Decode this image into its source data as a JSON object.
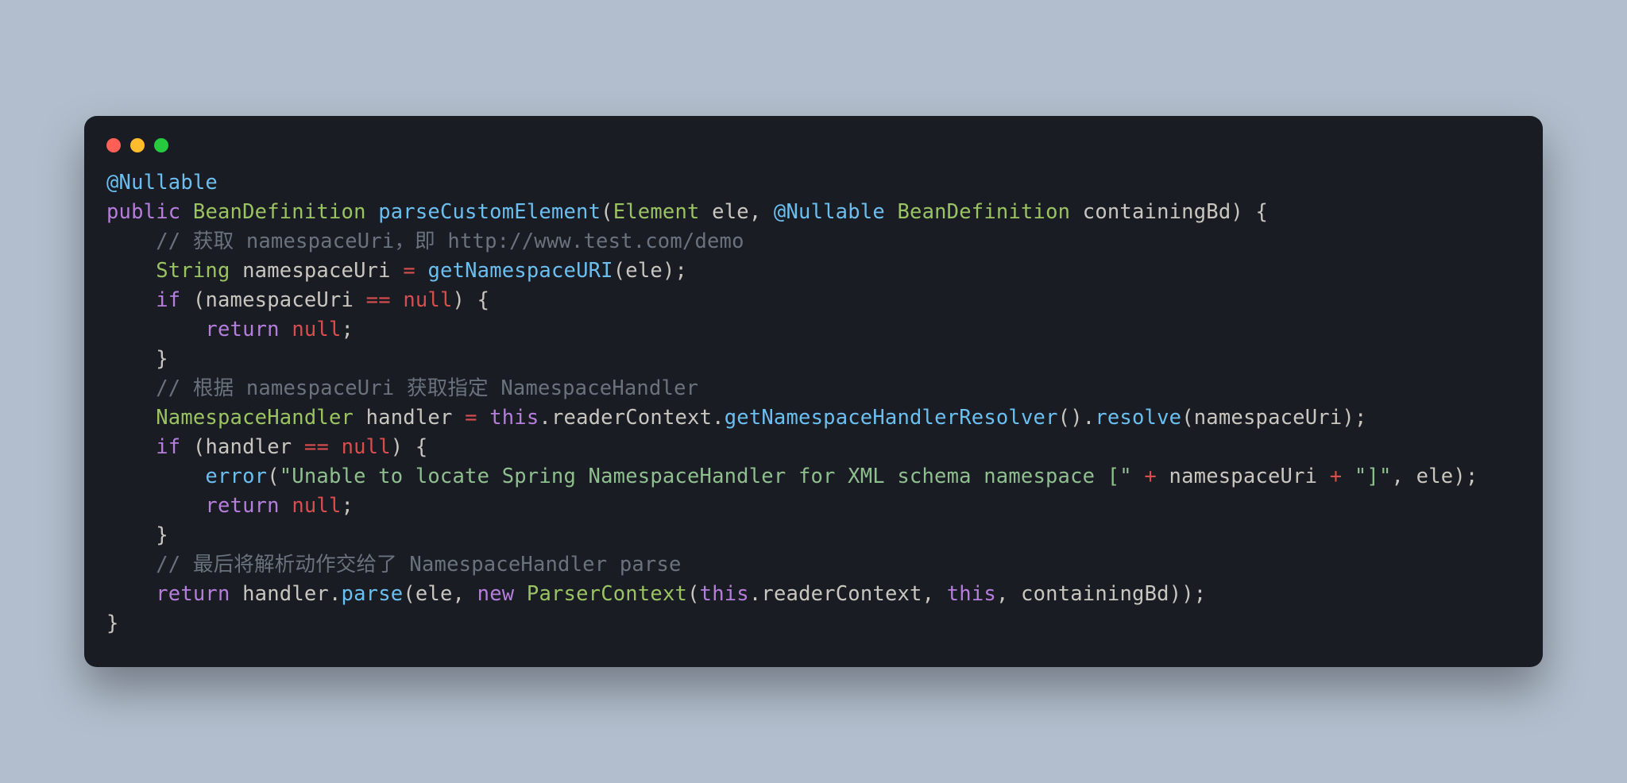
{
  "window": {
    "traffic_lights": [
      "red",
      "yellow",
      "green"
    ]
  },
  "code": {
    "lines": [
      [
        {
          "t": "@Nullable",
          "c": "tk-annotation"
        }
      ],
      [
        {
          "t": "public",
          "c": "tk-keyword"
        },
        {
          "t": " "
        },
        {
          "t": "BeanDefinition",
          "c": "tk-type"
        },
        {
          "t": " "
        },
        {
          "t": "parseCustomElement",
          "c": "tk-method"
        },
        {
          "t": "(",
          "c": "tk-punct"
        },
        {
          "t": "Element",
          "c": "tk-type"
        },
        {
          "t": " "
        },
        {
          "t": "ele",
          "c": "tk-ident"
        },
        {
          "t": ", ",
          "c": "tk-punct"
        },
        {
          "t": "@Nullable",
          "c": "tk-annotation"
        },
        {
          "t": " "
        },
        {
          "t": "BeanDefinition",
          "c": "tk-type"
        },
        {
          "t": " "
        },
        {
          "t": "containingBd",
          "c": "tk-ident"
        },
        {
          "t": ")",
          "c": "tk-punct"
        },
        {
          "t": " "
        },
        {
          "t": "{",
          "c": "tk-punct"
        }
      ],
      [
        {
          "t": "    "
        },
        {
          "t": "// 获取 namespaceUri，即 http://www.test.com/demo",
          "c": "tk-comment"
        }
      ],
      [
        {
          "t": "    "
        },
        {
          "t": "String",
          "c": "tk-type"
        },
        {
          "t": " "
        },
        {
          "t": "namespaceUri",
          "c": "tk-ident"
        },
        {
          "t": " "
        },
        {
          "t": "=",
          "c": "tk-op"
        },
        {
          "t": " "
        },
        {
          "t": "getNamespaceURI",
          "c": "tk-method"
        },
        {
          "t": "(",
          "c": "tk-punct"
        },
        {
          "t": "ele",
          "c": "tk-ident"
        },
        {
          "t": ")",
          "c": "tk-punct"
        },
        {
          "t": ";",
          "c": "tk-punct"
        }
      ],
      [
        {
          "t": "    "
        },
        {
          "t": "if",
          "c": "tk-keyword"
        },
        {
          "t": " "
        },
        {
          "t": "(",
          "c": "tk-punct"
        },
        {
          "t": "namespaceUri",
          "c": "tk-ident"
        },
        {
          "t": " "
        },
        {
          "t": "==",
          "c": "tk-op"
        },
        {
          "t": " "
        },
        {
          "t": "null",
          "c": "tk-null"
        },
        {
          "t": ")",
          "c": "tk-punct"
        },
        {
          "t": " "
        },
        {
          "t": "{",
          "c": "tk-punct"
        }
      ],
      [
        {
          "t": "        "
        },
        {
          "t": "return",
          "c": "tk-keyword"
        },
        {
          "t": " "
        },
        {
          "t": "null",
          "c": "tk-null"
        },
        {
          "t": ";",
          "c": "tk-punct"
        }
      ],
      [
        {
          "t": "    "
        },
        {
          "t": "}",
          "c": "tk-punct"
        }
      ],
      [
        {
          "t": "    "
        },
        {
          "t": "// 根据 namespaceUri 获取指定 NamespaceHandler",
          "c": "tk-comment"
        }
      ],
      [
        {
          "t": "    "
        },
        {
          "t": "NamespaceHandler",
          "c": "tk-type"
        },
        {
          "t": " "
        },
        {
          "t": "handler",
          "c": "tk-ident"
        },
        {
          "t": " "
        },
        {
          "t": "=",
          "c": "tk-op"
        },
        {
          "t": " "
        },
        {
          "t": "this",
          "c": "tk-keyword"
        },
        {
          "t": ".",
          "c": "tk-punct"
        },
        {
          "t": "readerContext",
          "c": "tk-ident"
        },
        {
          "t": ".",
          "c": "tk-punct"
        },
        {
          "t": "getNamespaceHandlerResolver",
          "c": "tk-method"
        },
        {
          "t": "()",
          "c": "tk-punct"
        },
        {
          "t": ".",
          "c": "tk-punct"
        },
        {
          "t": "resolve",
          "c": "tk-method"
        },
        {
          "t": "(",
          "c": "tk-punct"
        },
        {
          "t": "namespaceUri",
          "c": "tk-ident"
        },
        {
          "t": ")",
          "c": "tk-punct"
        },
        {
          "t": ";",
          "c": "tk-punct"
        }
      ],
      [
        {
          "t": "    "
        },
        {
          "t": "if",
          "c": "tk-keyword"
        },
        {
          "t": " "
        },
        {
          "t": "(",
          "c": "tk-punct"
        },
        {
          "t": "handler",
          "c": "tk-ident"
        },
        {
          "t": " "
        },
        {
          "t": "==",
          "c": "tk-op"
        },
        {
          "t": " "
        },
        {
          "t": "null",
          "c": "tk-null"
        },
        {
          "t": ")",
          "c": "tk-punct"
        },
        {
          "t": " "
        },
        {
          "t": "{",
          "c": "tk-punct"
        }
      ],
      [
        {
          "t": "        "
        },
        {
          "t": "error",
          "c": "tk-method"
        },
        {
          "t": "(",
          "c": "tk-punct"
        },
        {
          "t": "\"Unable to locate Spring NamespaceHandler for XML schema namespace [\"",
          "c": "tk-string"
        },
        {
          "t": " "
        },
        {
          "t": "+",
          "c": "tk-op"
        },
        {
          "t": " "
        },
        {
          "t": "namespaceUri",
          "c": "tk-ident"
        },
        {
          "t": " "
        },
        {
          "t": "+",
          "c": "tk-op"
        },
        {
          "t": " "
        },
        {
          "t": "\"]\"",
          "c": "tk-string"
        },
        {
          "t": ", ",
          "c": "tk-punct"
        },
        {
          "t": "ele",
          "c": "tk-ident"
        },
        {
          "t": ")",
          "c": "tk-punct"
        },
        {
          "t": ";",
          "c": "tk-punct"
        }
      ],
      [
        {
          "t": "        "
        },
        {
          "t": "return",
          "c": "tk-keyword"
        },
        {
          "t": " "
        },
        {
          "t": "null",
          "c": "tk-null"
        },
        {
          "t": ";",
          "c": "tk-punct"
        }
      ],
      [
        {
          "t": "    "
        },
        {
          "t": "}",
          "c": "tk-punct"
        }
      ],
      [
        {
          "t": "    "
        },
        {
          "t": "// 最后将解析动作交给了 NamespaceHandler parse",
          "c": "tk-comment"
        }
      ],
      [
        {
          "t": "    "
        },
        {
          "t": "return",
          "c": "tk-keyword"
        },
        {
          "t": " "
        },
        {
          "t": "handler",
          "c": "tk-ident"
        },
        {
          "t": ".",
          "c": "tk-punct"
        },
        {
          "t": "parse",
          "c": "tk-method"
        },
        {
          "t": "(",
          "c": "tk-punct"
        },
        {
          "t": "ele",
          "c": "tk-ident"
        },
        {
          "t": ", ",
          "c": "tk-punct"
        },
        {
          "t": "new",
          "c": "tk-keyword"
        },
        {
          "t": " "
        },
        {
          "t": "ParserContext",
          "c": "tk-type"
        },
        {
          "t": "(",
          "c": "tk-punct"
        },
        {
          "t": "this",
          "c": "tk-keyword"
        },
        {
          "t": ".",
          "c": "tk-punct"
        },
        {
          "t": "readerContext",
          "c": "tk-ident"
        },
        {
          "t": ", ",
          "c": "tk-punct"
        },
        {
          "t": "this",
          "c": "tk-keyword"
        },
        {
          "t": ", ",
          "c": "tk-punct"
        },
        {
          "t": "containingBd",
          "c": "tk-ident"
        },
        {
          "t": "))",
          "c": "tk-punct"
        },
        {
          "t": ";",
          "c": "tk-punct"
        }
      ],
      [
        {
          "t": "}",
          "c": "tk-punct"
        }
      ]
    ]
  }
}
